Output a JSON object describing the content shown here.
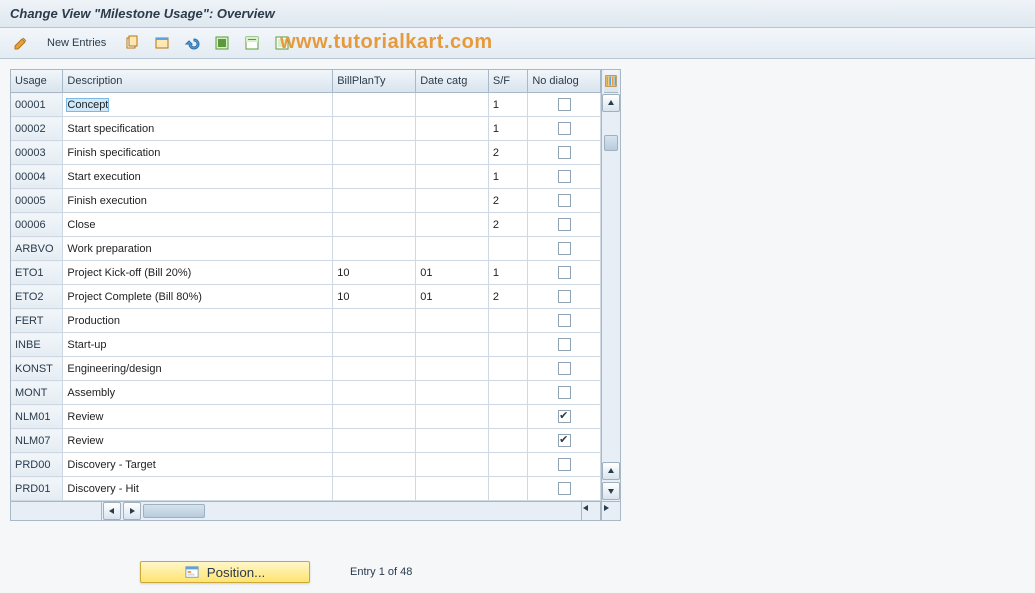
{
  "title": "Change View \"Milestone Usage\": Overview",
  "watermark": "www.tutorialkart.com",
  "toolbar": {
    "new_entries_label": "New Entries"
  },
  "columns": {
    "usage": "Usage",
    "description": "Description",
    "billplanty": "BillPlanTy",
    "datecatg": "Date catg",
    "sf": "S/F",
    "nodialog": "No dialog"
  },
  "rows": [
    {
      "usage": "00001",
      "description": "Concept",
      "billplanty": "",
      "datecatg": "",
      "sf": "1",
      "nodialog": false,
      "selected": true
    },
    {
      "usage": "00002",
      "description": "Start specification",
      "billplanty": "",
      "datecatg": "",
      "sf": "1",
      "nodialog": false
    },
    {
      "usage": "00003",
      "description": "Finish specification",
      "billplanty": "",
      "datecatg": "",
      "sf": "2",
      "nodialog": false
    },
    {
      "usage": "00004",
      "description": "Start execution",
      "billplanty": "",
      "datecatg": "",
      "sf": "1",
      "nodialog": false
    },
    {
      "usage": "00005",
      "description": "Finish execution",
      "billplanty": "",
      "datecatg": "",
      "sf": "2",
      "nodialog": false
    },
    {
      "usage": "00006",
      "description": "Close",
      "billplanty": "",
      "datecatg": "",
      "sf": "2",
      "nodialog": false
    },
    {
      "usage": "ARBVO",
      "description": "Work preparation",
      "billplanty": "",
      "datecatg": "",
      "sf": "",
      "nodialog": false
    },
    {
      "usage": "ETO1",
      "description": "Project Kick-off (Bill 20%)",
      "billplanty": "10",
      "datecatg": "01",
      "sf": "1",
      "nodialog": false
    },
    {
      "usage": "ETO2",
      "description": "Project Complete (Bill 80%)",
      "billplanty": "10",
      "datecatg": "01",
      "sf": "2",
      "nodialog": false
    },
    {
      "usage": "FERT",
      "description": "Production",
      "billplanty": "",
      "datecatg": "",
      "sf": "",
      "nodialog": false
    },
    {
      "usage": "INBE",
      "description": "Start-up",
      "billplanty": "",
      "datecatg": "",
      "sf": "",
      "nodialog": false
    },
    {
      "usage": "KONST",
      "description": "Engineering/design",
      "billplanty": "",
      "datecatg": "",
      "sf": "",
      "nodialog": false
    },
    {
      "usage": "MONT",
      "description": "Assembly",
      "billplanty": "",
      "datecatg": "",
      "sf": "",
      "nodialog": false
    },
    {
      "usage": "NLM01",
      "description": "Review",
      "billplanty": "",
      "datecatg": "",
      "sf": "",
      "nodialog": true
    },
    {
      "usage": "NLM07",
      "description": "Review",
      "billplanty": "",
      "datecatg": "",
      "sf": "",
      "nodialog": true
    },
    {
      "usage": "PRD00",
      "description": "Discovery - Target",
      "billplanty": "",
      "datecatg": "",
      "sf": "",
      "nodialog": false
    },
    {
      "usage": "PRD01",
      "description": "Discovery - Hit",
      "billplanty": "",
      "datecatg": "",
      "sf": "",
      "nodialog": false
    }
  ],
  "footer": {
    "position_label": "Position...",
    "entry_info": "Entry 1 of 48"
  }
}
